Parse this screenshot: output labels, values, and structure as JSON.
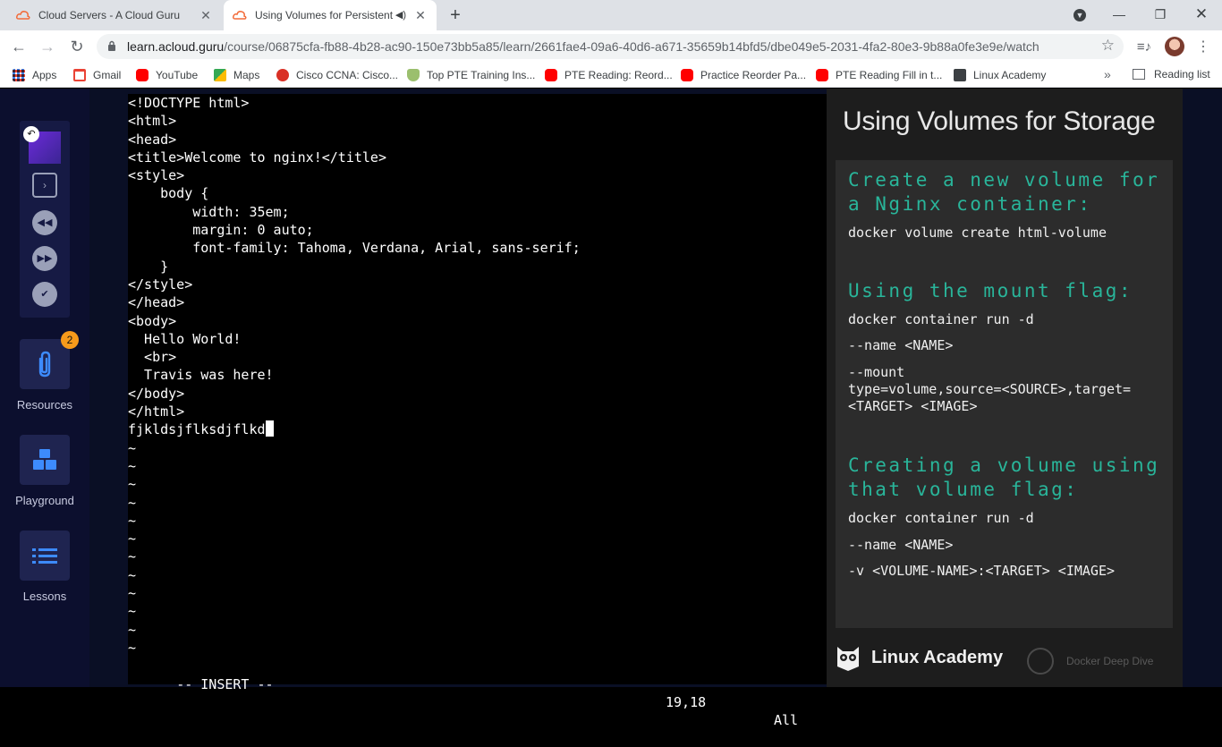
{
  "browser": {
    "tabs": [
      {
        "title": "Cloud Servers - A Cloud Guru",
        "active": false
      },
      {
        "title": "Using Volumes for Persistent",
        "active": true
      }
    ],
    "url_host": "learn.acloud.guru",
    "url_path": "/course/06875cfa-fb88-4b28-ac90-150e73bb5a85/learn/2661fae4-09a6-40d6-a671-35659b14bfd5/dbe049e5-2031-4fa2-80e3-9b88a0fe3e9e/watch",
    "bookmarks": [
      {
        "label": "Apps",
        "color": "#4285f4"
      },
      {
        "label": "Gmail",
        "color": "#ea4335"
      },
      {
        "label": "YouTube",
        "color": "#ff0000"
      },
      {
        "label": "Maps",
        "color": "#34a853"
      },
      {
        "label": "Cisco CCNA: Cisco...",
        "color": "#d93025"
      },
      {
        "label": "Top PTE Training Ins...",
        "color": "#5f8f3a"
      },
      {
        "label": "PTE Reading: Reord...",
        "color": "#ff0000"
      },
      {
        "label": "Practice Reorder Pa...",
        "color": "#ff0000"
      },
      {
        "label": "PTE Reading Fill in t...",
        "color": "#ff0000"
      },
      {
        "label": "Linux Academy",
        "color": "#3c4043"
      }
    ],
    "bookmarks_more": "»",
    "reading_list": "Reading list"
  },
  "sidebar": {
    "resources_label": "Resources",
    "resources_badge": "2",
    "playground_label": "Playground",
    "lessons_label": "Lessons"
  },
  "terminal": {
    "lines": [
      "<!DOCTYPE html>",
      "<html>",
      "<head>",
      "<title>Welcome to nginx!</title>",
      "<style>",
      "    body {",
      "        width: 35em;",
      "        margin: 0 auto;",
      "        font-family: Tahoma, Verdana, Arial, sans-serif;",
      "    }",
      "</style>",
      "</head>",
      "<body>",
      "  Hello World!",
      "  <br>",
      "  Travis was here!",
      "</body>",
      "</html>"
    ],
    "current_line": "fjkldsjflksdjflkd",
    "tilde_lines": [
      "~",
      "~",
      "~",
      "~",
      "~",
      "~",
      "~",
      "~",
      "~",
      "~",
      "~",
      "~"
    ],
    "mode": "-- INSERT --",
    "position": "19,18",
    "scroll": "All"
  },
  "slide": {
    "title": "Using Volumes for Storage",
    "section1_heading": "Create a new volume for a Nginx container:",
    "section1_cmd": "docker volume create html-volume",
    "section2_heading": "Using the mount flag:",
    "section2_cmd1": "docker container run -d",
    "section2_cmd2": "--name <NAME>",
    "section2_cmd3": "--mount\ntype=volume,source=<SOURCE>,target=\n<TARGET> <IMAGE>",
    "section3_heading": "Creating a volume using that volume flag:",
    "section3_cmd1": "docker container run -d",
    "section3_cmd2": "--name <NAME>",
    "section3_cmd3": "-v <VOLUME-NAME>:<TARGET> <IMAGE>",
    "brand": "Linux Academy",
    "course": "Docker Deep Dive"
  }
}
